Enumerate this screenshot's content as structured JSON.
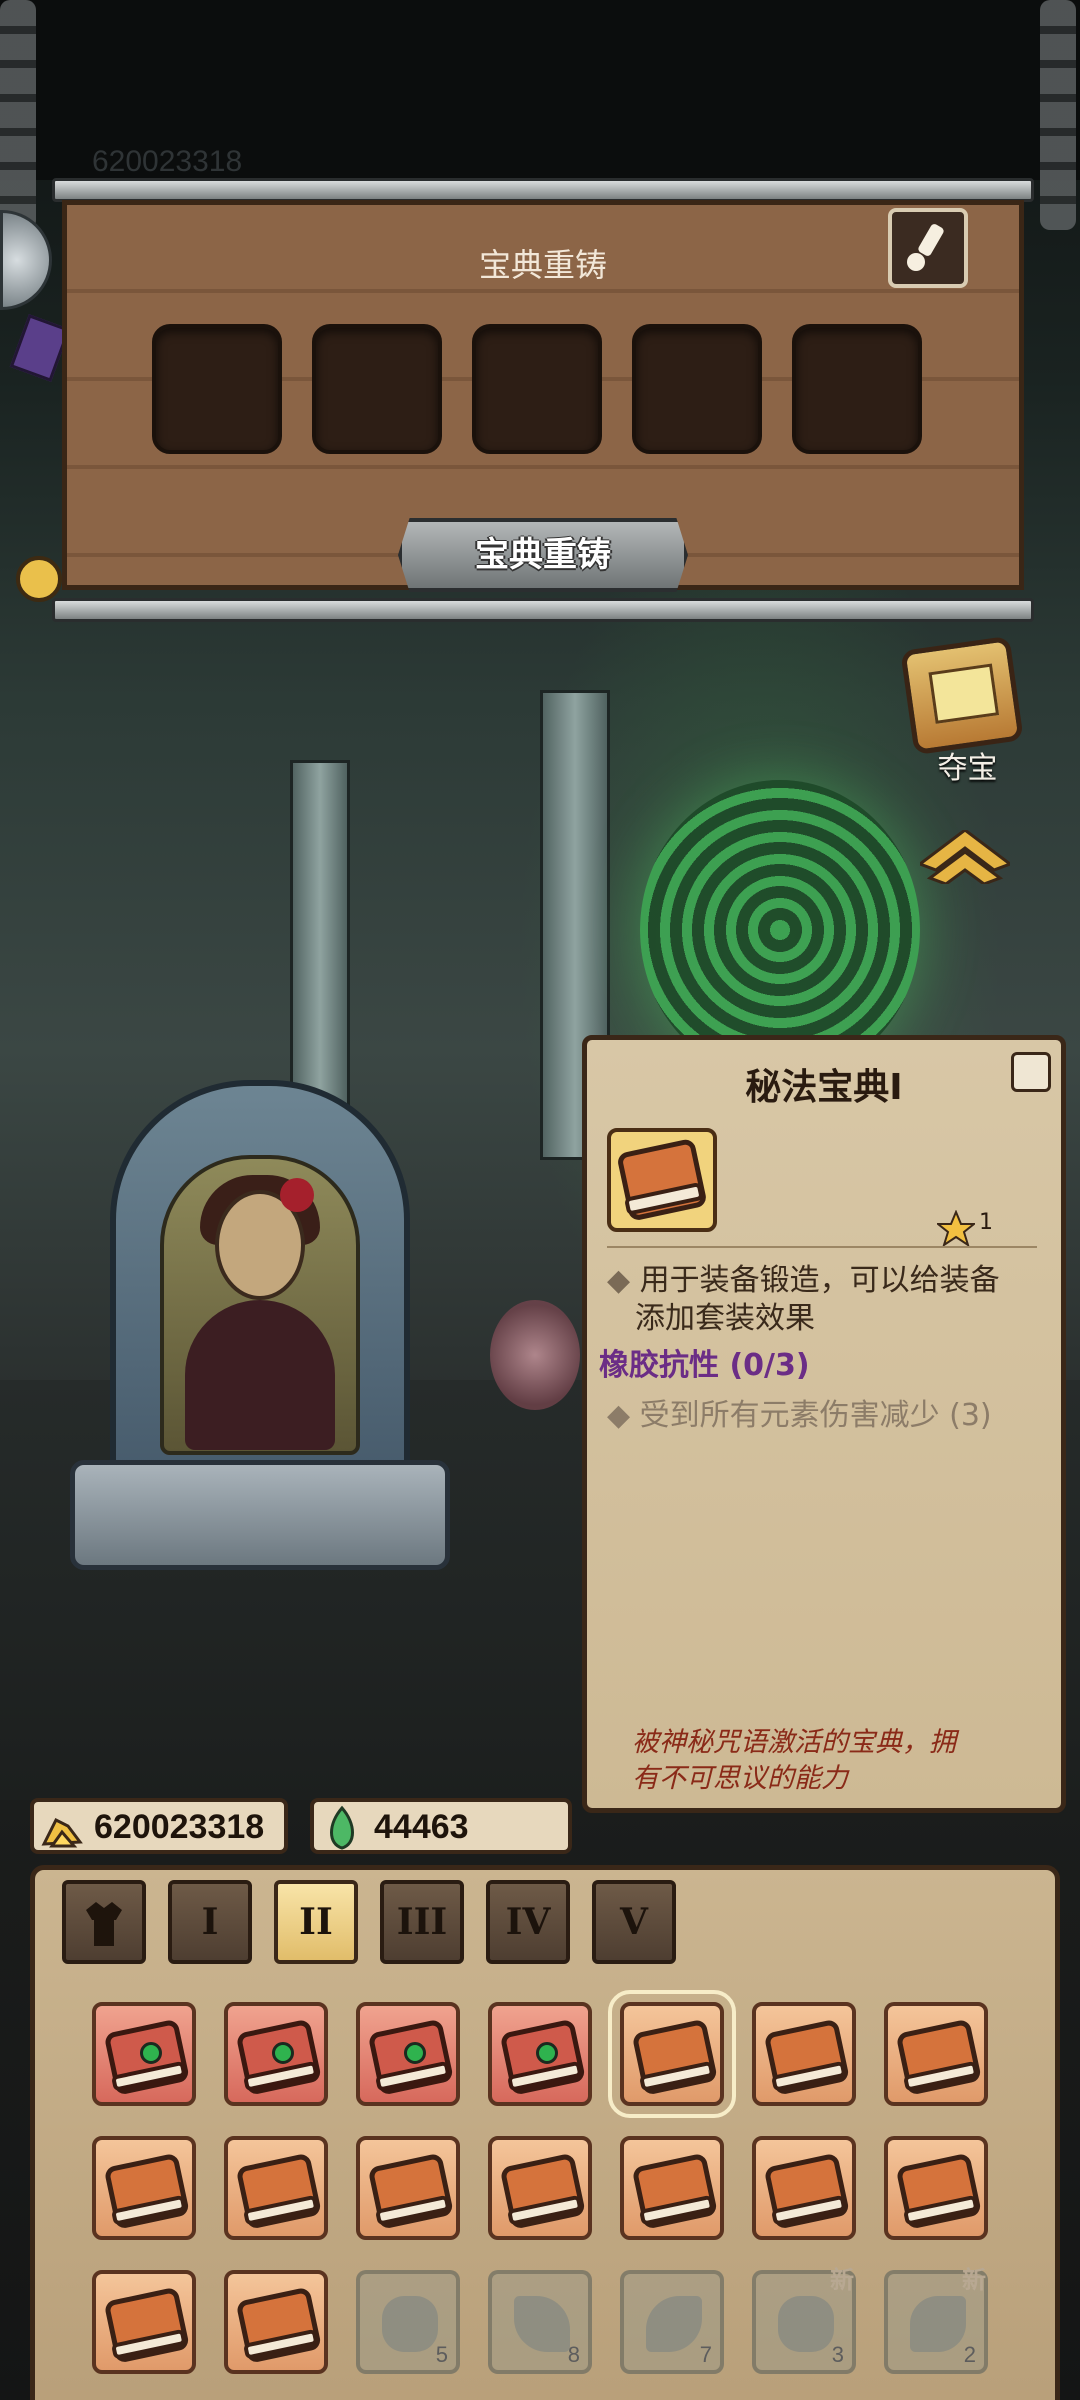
{
  "background": {
    "ghost_text": "620023318"
  },
  "reforge_panel": {
    "title": "宝典重铸",
    "slot_count": 5,
    "button_label": "宝典重铸"
  },
  "treasure": {
    "label": "夺宝"
  },
  "info_card": {
    "title": "秘法宝典Ⅰ",
    "star_count": "1",
    "description_line1": "用于装备锻造，可以给装备",
    "description_line2": "添加套装效果",
    "set_name": "橡胶抗性 (0/3)",
    "set_effect": "受到所有元素伤害减少 (3)",
    "flavor_line1": "被神秘咒语激活的宝典，拥",
    "flavor_line2": "有不可思议的能力"
  },
  "currencies": {
    "gold": "620023318",
    "essence": "44463"
  },
  "tabs": [
    {
      "label": "",
      "icon": "shirt-icon",
      "active": false
    },
    {
      "label": "I",
      "active": false
    },
    {
      "label": "II",
      "active": true
    },
    {
      "label": "III",
      "active": false
    },
    {
      "label": "IV",
      "active": false
    },
    {
      "label": "V",
      "active": false
    }
  ],
  "inventory": {
    "row1": [
      "book-gem-red",
      "book-gem-red",
      "book-gem-red",
      "book-gem-red",
      "book-orange-selected",
      "book-orange",
      "book-orange"
    ],
    "row2": [
      "book-orange",
      "book-orange",
      "book-orange",
      "book-orange",
      "book-orange",
      "book-orange",
      "book-orange"
    ],
    "row3": [
      "book-orange",
      "book-orange",
      "locked",
      "locked",
      "locked",
      "locked",
      "locked"
    ],
    "locked_counts": [
      "5",
      "8",
      "7",
      "3",
      "2"
    ],
    "new_badge": "新"
  },
  "colors": {
    "wood": "#8c6547",
    "parchment": "#d8c7a6",
    "set_name": "#6b2d86",
    "flavor": "#8a2a18",
    "active_tab": "#f8e4a8"
  }
}
